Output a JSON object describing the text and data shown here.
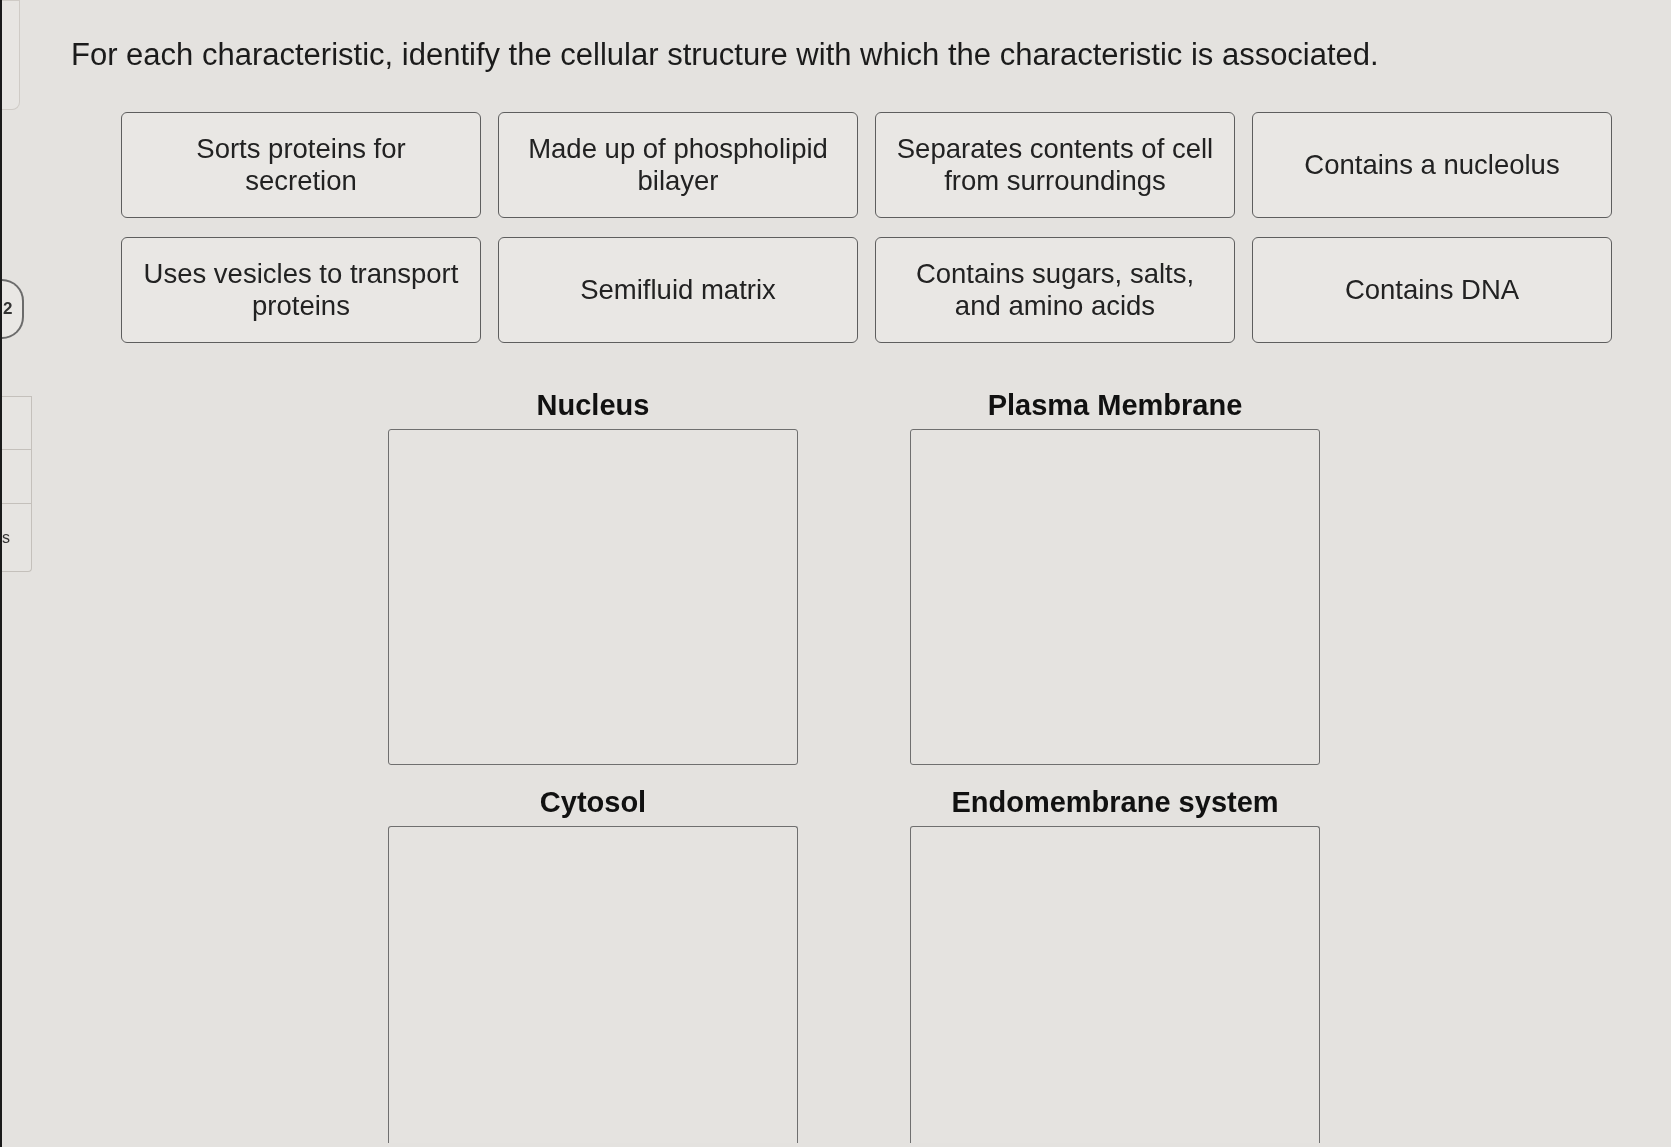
{
  "instruction": "For each characteristic, identify the cellular structure with which the characteristic is associated.",
  "sidebar": {
    "question_number": "2",
    "cell_text": "s"
  },
  "cards": [
    {
      "text": "Sorts proteins for\nsecretion"
    },
    {
      "text": "Made up of phospholipid\nbilayer"
    },
    {
      "text": "Separates contents of cell\nfrom surroundings"
    },
    {
      "text": "Contains a nucleolus"
    },
    {
      "text": "Uses vesicles to transport\nproteins"
    },
    {
      "text": "Semifluid matrix"
    },
    {
      "text": "Contains sugars, salts,\nand amino acids"
    },
    {
      "text": "Contains DNA"
    }
  ],
  "drop_zones": [
    {
      "label": "Nucleus"
    },
    {
      "label": "Plasma Membrane"
    },
    {
      "label": "Cytosol"
    },
    {
      "label": "Endomembrane system"
    }
  ]
}
